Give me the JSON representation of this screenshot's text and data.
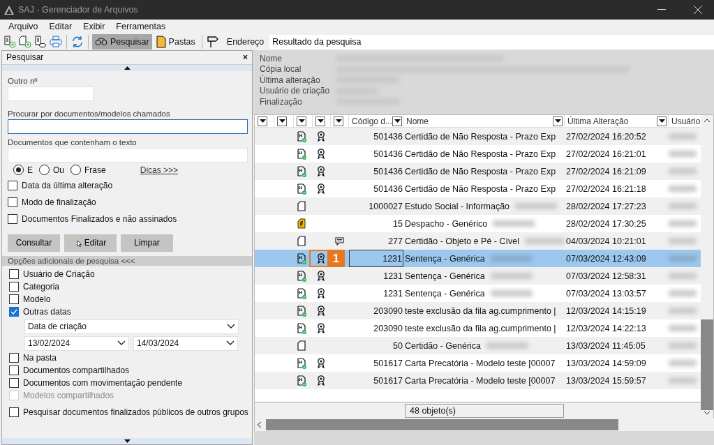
{
  "window": {
    "title": "SAJ - Gerenciador de Arquivos"
  },
  "menu": [
    "Arquivo",
    "Editar",
    "Exibir",
    "Ferramentas"
  ],
  "toolbar": {
    "buttons": [
      {
        "kind": "new-doc"
      },
      {
        "kind": "new-blank"
      },
      {
        "kind": "doc-disk"
      },
      {
        "kind": "print"
      },
      {
        "kind": "sep"
      },
      {
        "kind": "refresh"
      },
      {
        "kind": "sep"
      },
      {
        "kind": "search",
        "label": "Pesquisar",
        "selected": true
      },
      {
        "kind": "folder",
        "label": "Pastas",
        "selected": false
      },
      {
        "kind": "sep"
      },
      {
        "kind": "sign"
      }
    ],
    "address_label": "Endereço",
    "address": "Resultado da pesquisa"
  },
  "search_panel": {
    "title": "Pesquisar",
    "close": "×",
    "outro_label": "Outro nº",
    "name_label": "Procurar por documentos/modelos chamados",
    "text_label": "Documentos que contenham o texto",
    "radios": [
      {
        "label": "E",
        "selected": true
      },
      {
        "label": "Ou",
        "selected": false
      },
      {
        "label": "Frase",
        "selected": false
      }
    ],
    "tips_link": "Dicas >>>",
    "checks": [
      {
        "label": "Data da última alteração",
        "checked": false
      },
      {
        "label": "Modo de finalização",
        "checked": false
      },
      {
        "label": "Documentos Finalizados e não assinados",
        "checked": false
      }
    ],
    "buttons": [
      "Consultar",
      "Editar",
      "Limpar"
    ],
    "more_title": "Opções adicionais de pesquisa <<<",
    "more": [
      {
        "kind": "check",
        "label": "Usuário de Criação",
        "checked": false,
        "disabled": false
      },
      {
        "kind": "check",
        "label": "Categoria",
        "checked": false,
        "disabled": false
      },
      {
        "kind": "check",
        "label": "Modelo",
        "checked": false,
        "disabled": false
      },
      {
        "kind": "check",
        "label": "Outras datas",
        "checked": true,
        "disabled": false
      },
      {
        "kind": "select",
        "value": "Data de criação"
      },
      {
        "kind": "dates",
        "from": "13/02/2024",
        "to": "14/03/2024"
      },
      {
        "kind": "check",
        "label": "Na pasta",
        "checked": false,
        "disabled": false
      },
      {
        "kind": "check",
        "label": "Documentos compartilhados",
        "checked": false,
        "disabled": false
      },
      {
        "kind": "check",
        "label": "Documentos com movimentação pendente",
        "checked": false,
        "disabled": false
      },
      {
        "kind": "check",
        "label": "Modelos compartilhados",
        "checked": false,
        "disabled": true
      },
      {
        "kind": "check",
        "label": "Pesquisar documentos finalizados públicos de outros grupos",
        "checked": false,
        "disabled": false
      }
    ]
  },
  "details": [
    "Nome",
    "Cópia local",
    "Última alteração",
    "Usuário de criação",
    "Finalização"
  ],
  "table": {
    "columns": [
      {
        "kind": "filter"
      },
      {
        "kind": "filter"
      },
      {
        "kind": "filter"
      },
      {
        "kind": "filter"
      },
      {
        "kind": "filter"
      },
      {
        "label": "Código d..."
      },
      {
        "label": "Nome"
      },
      {
        "label": "Última Alteração"
      },
      {
        "label": "Usuário"
      }
    ],
    "rows": [
      {
        "kind": "signed",
        "seal": true,
        "comment": false,
        "code": "501436",
        "name": "Certidão de Não Resposta - Prazo Exp",
        "redacted": false,
        "date": "27/02/2024 16:20:52",
        "selected": false
      },
      {
        "kind": "signed",
        "seal": true,
        "comment": false,
        "code": "501436",
        "name": "Certidão de Não Resposta - Prazo Exp",
        "redacted": false,
        "date": "27/02/2024 16:21:01",
        "selected": false
      },
      {
        "kind": "signed",
        "seal": true,
        "comment": false,
        "code": "501436",
        "name": "Certidão de Não Resposta - Prazo Exp",
        "redacted": false,
        "date": "27/02/2024 16:21:09",
        "selected": false
      },
      {
        "kind": "signed",
        "seal": true,
        "comment": false,
        "code": "501436",
        "name": "Certidão de Não Resposta - Prazo Exp",
        "redacted": false,
        "date": "27/02/2024 16:21:18",
        "selected": false
      },
      {
        "kind": "blank",
        "seal": false,
        "comment": false,
        "code": "1000027",
        "name": "Estudo Social - Informação",
        "redacted": true,
        "date": "28/02/2024 17:27:23",
        "selected": false
      },
      {
        "kind": "draft",
        "seal": false,
        "comment": false,
        "code": "15",
        "name": "Despacho - Genérico",
        "redacted": true,
        "date": "28/02/2024 17:30:25",
        "selected": false
      },
      {
        "kind": "blank",
        "seal": false,
        "comment": true,
        "code": "277",
        "name": "Certidão - Objeto e Pé - Cível",
        "redacted": true,
        "date": "04/03/2024 10:21:01",
        "selected": false
      },
      {
        "kind": "signed",
        "seal": true,
        "comment": false,
        "code": "1231",
        "name": "Sentença - Genérica",
        "redacted": true,
        "date": "07/03/2024 12:43:09",
        "selected": true,
        "callout": "1"
      },
      {
        "kind": "signed",
        "seal": true,
        "comment": false,
        "code": "1231",
        "name": "Sentença - Genérica",
        "redacted": true,
        "date": "07/03/2024 12:58:31",
        "selected": false
      },
      {
        "kind": "signed",
        "seal": true,
        "comment": false,
        "code": "1231",
        "name": "Sentença - Genérica",
        "redacted": true,
        "date": "07/03/2024 13:03:57",
        "selected": false
      },
      {
        "kind": "signed",
        "seal": true,
        "comment": false,
        "code": "203090",
        "name": "teste exclusão da fila ag.cumprimento |",
        "redacted": false,
        "date": "12/03/2024 14:15:19",
        "selected": false
      },
      {
        "kind": "signed",
        "seal": true,
        "comment": false,
        "code": "203090",
        "name": "teste exclusão da fila ag.cumprimento |",
        "redacted": false,
        "date": "12/03/2024 14:22:13",
        "selected": false
      },
      {
        "kind": "blank",
        "seal": false,
        "comment": false,
        "code": "50",
        "name": "Certidão - Genérica",
        "redacted": true,
        "date": "13/03/2024 11:45:05",
        "selected": false
      },
      {
        "kind": "signed",
        "seal": true,
        "comment": false,
        "code": "501617",
        "name": "Carta Precatória - Modelo teste [00007",
        "redacted": false,
        "date": "13/03/2024 14:59:09",
        "selected": false
      },
      {
        "kind": "signed",
        "seal": true,
        "comment": false,
        "code": "501617",
        "name": "Carta Precatória - Modelo teste [00007",
        "redacted": false,
        "date": "13/03/2024 15:59:57",
        "selected": false
      }
    ]
  },
  "status": "48 objeto(s)"
}
